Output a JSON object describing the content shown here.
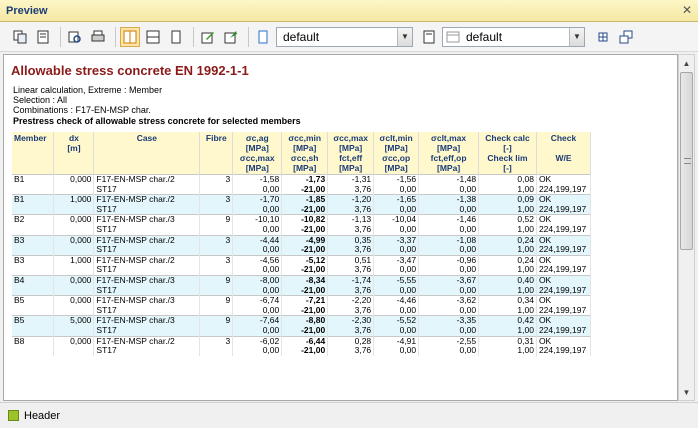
{
  "window": {
    "title": "Preview"
  },
  "toolbar": {
    "combo1": "default",
    "combo2": "default"
  },
  "report": {
    "title": "Allowable stress concrete EN 1992-1-1",
    "info": [
      "Linear calculation, Extreme : Member",
      "Selection : All",
      "Combinations : F17-EN-MSP char."
    ],
    "subtitle": "Prestress check of allowable stress concrete for selected members",
    "headers": {
      "member": "Member",
      "dx": "dx",
      "dx_unit": "[m]",
      "case": "Case",
      "fibre": "Fibre",
      "sig1": "σc,ag",
      "sig1u": "[MPa]",
      "sig1b": "σcc,max",
      "sig1bu": "[MPa]",
      "sig2": "σcc,min",
      "sig2u": "[MPa]",
      "sig2b": "σcc,sh",
      "sig2bu": "[MPa]",
      "sig3": "σcc,max",
      "sig3u": "[MPa]",
      "sig3b": "fct,eff",
      "sig3bu": "[MPa]",
      "sig4": "σclt,min",
      "sig4u": "[MPa]",
      "sig4b": "σcc,op",
      "sig4bu": "[MPa]",
      "sig5": "σclt,max",
      "sig5u": "[MPa]",
      "sig5b": "fct,eff,op",
      "sig5bu": "[MPa]",
      "chk1": "Check calc",
      "chk1u": "[-]",
      "chk2": "Check lim",
      "chk2u": "[-]",
      "chk3": "Check",
      "chk3b": "W/E"
    },
    "rows": [
      [
        "B1",
        "0,000",
        "F17-EN-MSP char./2",
        "3",
        "-1,58",
        "-1,73",
        "-1,31",
        "-1,56",
        "-1,48",
        "0,08",
        "OK"
      ],
      [
        "",
        "",
        "ST17",
        "",
        "0,00",
        "-21,00",
        "3,76",
        "0,00",
        "0,00",
        "1,00",
        "224,199,197"
      ],
      [
        "B1",
        "1,000",
        "F17-EN-MSP char./2",
        "3",
        "-1,70",
        "-1,85",
        "-1,20",
        "-1,65",
        "-1,38",
        "0,09",
        "OK"
      ],
      [
        "",
        "",
        "ST17",
        "",
        "0,00",
        "-21,00",
        "3,76",
        "0,00",
        "0,00",
        "1,00",
        "224,199,197"
      ],
      [
        "B2",
        "0,000",
        "F17-EN-MSP char./3",
        "9",
        "-10,10",
        "-10,82",
        "-1,13",
        "-10,04",
        "-1,46",
        "0,52",
        "OK"
      ],
      [
        "",
        "",
        "ST17",
        "",
        "0,00",
        "-21,00",
        "3,76",
        "0,00",
        "0,00",
        "1,00",
        "224,199,197"
      ],
      [
        "B3",
        "0,000",
        "F17-EN-MSP char./2",
        "3",
        "-4,44",
        "-4,99",
        "0,35",
        "-3,37",
        "-1,08",
        "0,24",
        "OK"
      ],
      [
        "",
        "",
        "ST17",
        "",
        "0,00",
        "-21,00",
        "3,76",
        "0,00",
        "0,00",
        "1,00",
        "224,199,197"
      ],
      [
        "B3",
        "1,000",
        "F17-EN-MSP char./2",
        "3",
        "-4,56",
        "-5,12",
        "0,51",
        "-3,47",
        "-0,96",
        "0,24",
        "OK"
      ],
      [
        "",
        "",
        "ST17",
        "",
        "0,00",
        "-21,00",
        "3,76",
        "0,00",
        "0,00",
        "1,00",
        "224,199,197"
      ],
      [
        "B4",
        "0,000",
        "F17-EN-MSP char./3",
        "9",
        "-8,00",
        "-8,34",
        "-1,74",
        "-5,55",
        "-3,67",
        "0,40",
        "OK"
      ],
      [
        "",
        "",
        "ST17",
        "",
        "0,00",
        "-21,00",
        "3,76",
        "0,00",
        "0,00",
        "1,00",
        "224,199,197"
      ],
      [
        "B5",
        "0,000",
        "F17-EN-MSP char./3",
        "9",
        "-6,74",
        "-7,21",
        "-2,20",
        "-4,46",
        "-3,62",
        "0,34",
        "OK"
      ],
      [
        "",
        "",
        "ST17",
        "",
        "0,00",
        "-21,00",
        "3,76",
        "0,00",
        "0,00",
        "1,00",
        "224,199,197"
      ],
      [
        "B5",
        "5,000",
        "F17-EN-MSP char./3",
        "9",
        "-7,64",
        "-8,80",
        "-2,30",
        "-5,52",
        "-3,35",
        "0,42",
        "OK"
      ],
      [
        "",
        "",
        "ST17",
        "",
        "0,00",
        "-21,00",
        "3,76",
        "0,00",
        "0,00",
        "1,00",
        "224,199,197"
      ],
      [
        "B8",
        "0,000",
        "F17-EN-MSP char./2",
        "3",
        "-6,02",
        "-6,44",
        "0,28",
        "-4,91",
        "-2,55",
        "0,31",
        "OK"
      ],
      [
        "",
        "",
        "ST17",
        "",
        "0,00",
        "-21,00",
        "3,76",
        "0,00",
        "0,00",
        "1,00",
        "224,199,197"
      ]
    ]
  },
  "status": {
    "label": "Header"
  }
}
